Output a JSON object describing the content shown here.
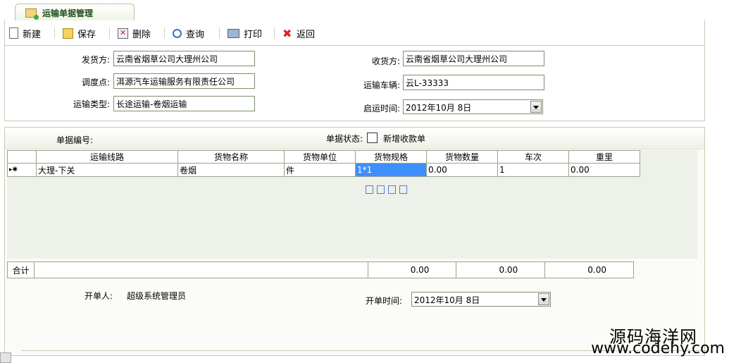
{
  "tab": {
    "title": "运输单据管理"
  },
  "toolbar": {
    "new_label": "新建",
    "save_label": "保存",
    "delete_label": "删除",
    "query_label": "查询",
    "print_label": "打印",
    "back_label": "返回"
  },
  "form": {
    "shipper_label": "发货方:",
    "shipper_value": "云南省烟草公司大理州公司",
    "dispatch_label": "调度点:",
    "dispatch_value": "洱源汽车运输服务有限责任公司",
    "type_label": "运输类型:",
    "type_value": "长途运输-卷烟运输",
    "receiver_label": "收货方:",
    "receiver_value": "云南省烟草公司大理州公司",
    "vehicle_label": "运输车辆:",
    "vehicle_value": "云L-33333",
    "start_time_label": "启运时间:",
    "start_time_value": "2012年10月 8日"
  },
  "doc": {
    "number_label": "单据编号:",
    "status_label": "单据状态:",
    "new_receipt_label": "新增收款单"
  },
  "grid": {
    "columns": [
      "运输线路",
      "货物名称",
      "货物单位",
      "货物规格",
      "货物数量",
      "车次",
      "重里"
    ],
    "row_marker": "▸✱",
    "rows": [
      [
        "大理-下关",
        "卷烟",
        "件",
        "1*1",
        "0.00",
        "1",
        "0.00"
      ]
    ]
  },
  "summary": {
    "label": "合计",
    "qty": "0.00",
    "trips": "0.00",
    "weight": "0.00"
  },
  "footer": {
    "creator_label": "开单人:",
    "creator_value": "超级系统管理员",
    "created_time_label": "开单时间:",
    "created_time_value": "2012年10月 8日"
  },
  "watermark": {
    "line1": "源码海洋网",
    "line2": "www.codehy.com"
  },
  "colors": {
    "accent": "#1f4f1b",
    "selection": "#3d8fff",
    "border": "#9aa48a"
  }
}
